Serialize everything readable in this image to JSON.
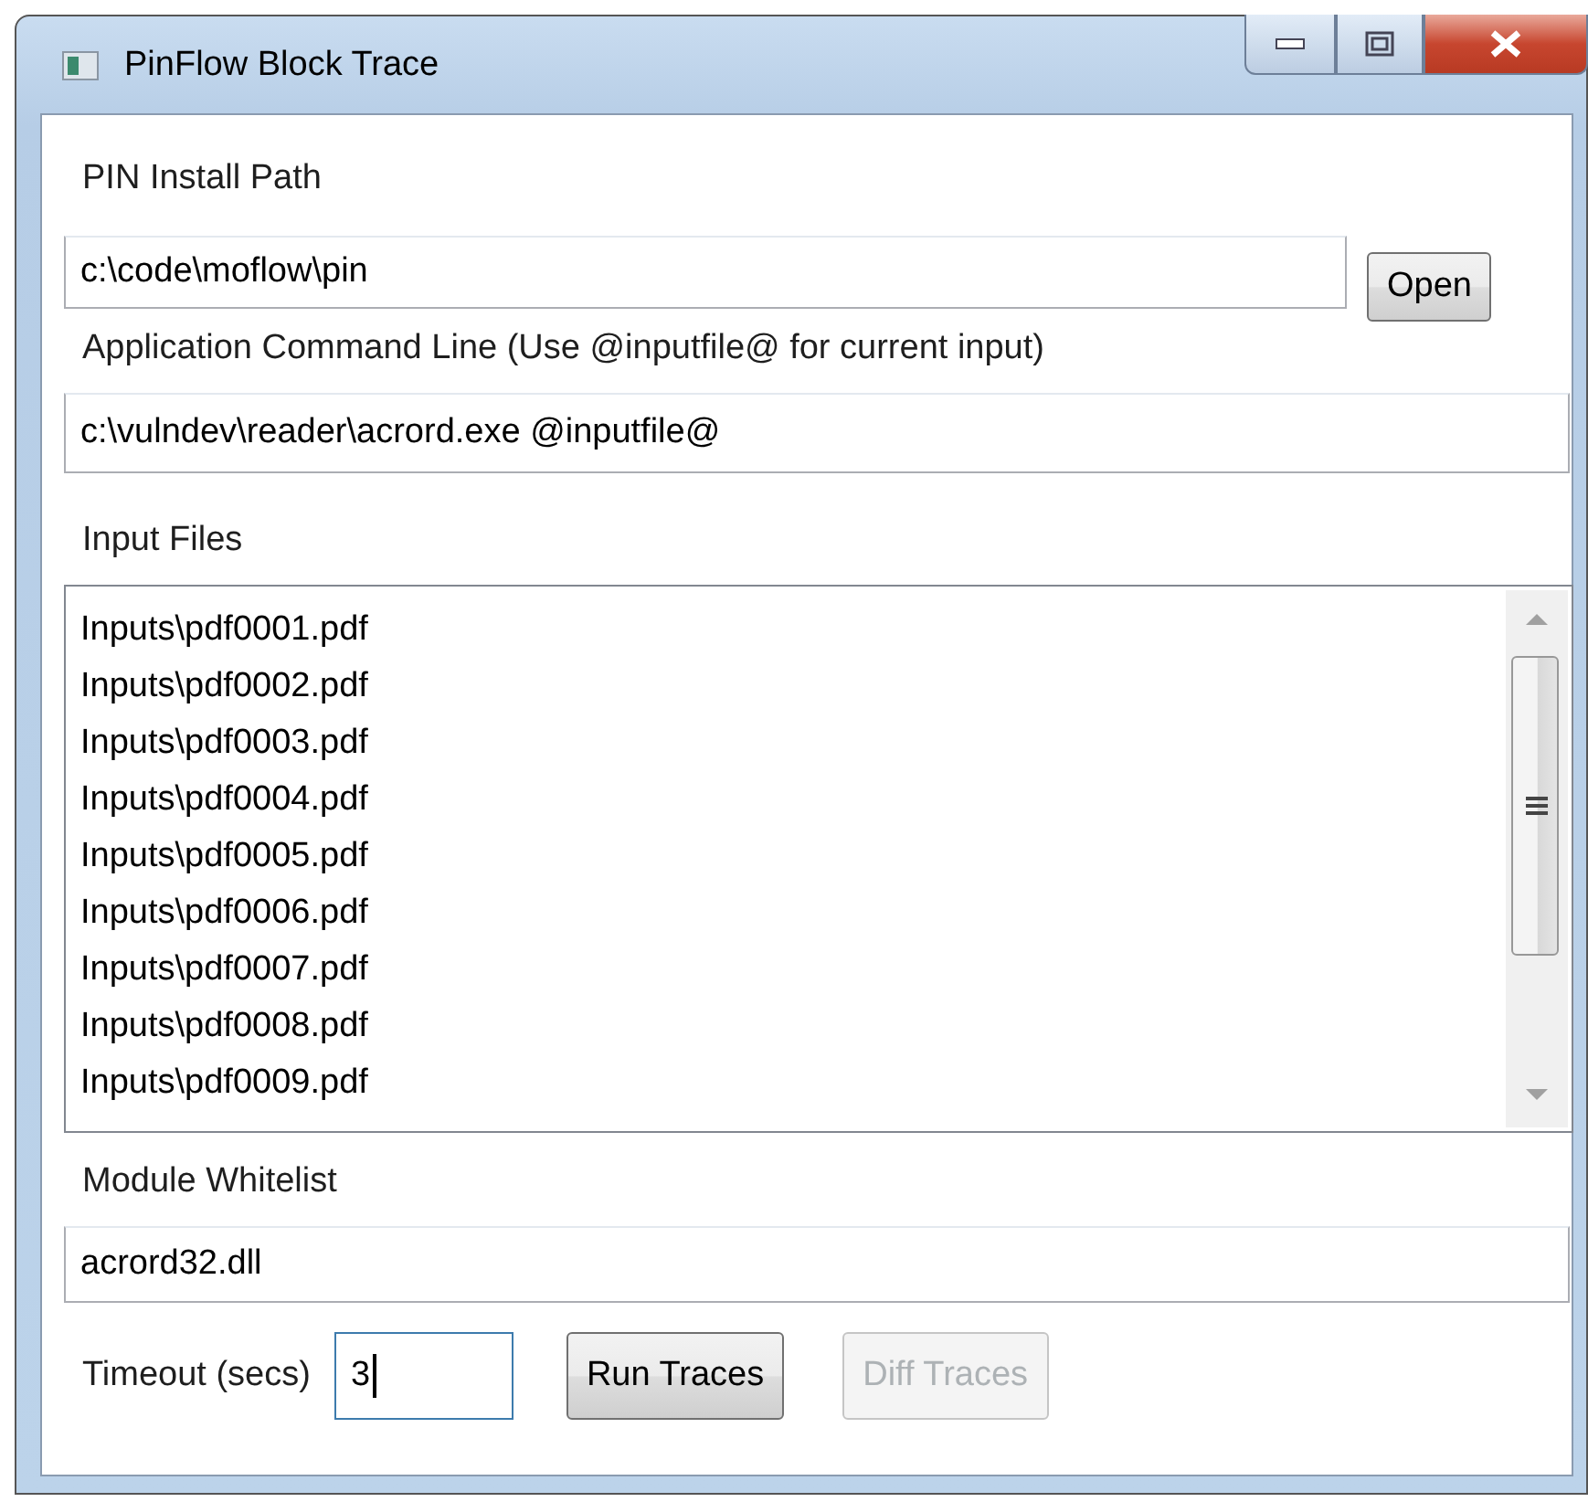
{
  "window": {
    "title": "PinFlow Block Trace"
  },
  "pin_install_path": {
    "label": "PIN Install Path",
    "value": "c:\\code\\moflow\\pin",
    "button": {
      "label": "Open",
      "disabled": false
    }
  },
  "command_line": {
    "label": "Application Command Line (Use @inputfile@ for current input)",
    "value": "c:\\vulndev\\reader\\acrord.exe @inputfile@"
  },
  "input_files": {
    "label": "Input Files",
    "items": [
      {
        "text": "Inputs\\pdf0001.pdf",
        "selected": false
      },
      {
        "text": "Inputs\\pdf0002.pdf",
        "selected": false
      },
      {
        "text": "Inputs\\pdf0003.pdf",
        "selected": false
      },
      {
        "text": "Inputs\\pdf0004.pdf",
        "selected": false
      },
      {
        "text": "Inputs\\pdf0005.pdf",
        "selected": false
      },
      {
        "text": "Inputs\\pdf0006.pdf",
        "selected": false
      },
      {
        "text": "Inputs\\pdf0007.pdf",
        "selected": false
      },
      {
        "text": "Inputs\\pdf0008.pdf",
        "selected": false
      },
      {
        "text": "Inputs\\pdf0009.pdf",
        "selected": false
      }
    ]
  },
  "module_whitelist": {
    "label": "Module Whitelist",
    "value": "acrord32.dll"
  },
  "timeout": {
    "label": "Timeout (secs)",
    "value": "3",
    "focused": true
  },
  "buttons": [
    {
      "label": "Run Traces",
      "disabled": false
    },
    {
      "label": "Diff Traces",
      "disabled": true
    }
  ]
}
